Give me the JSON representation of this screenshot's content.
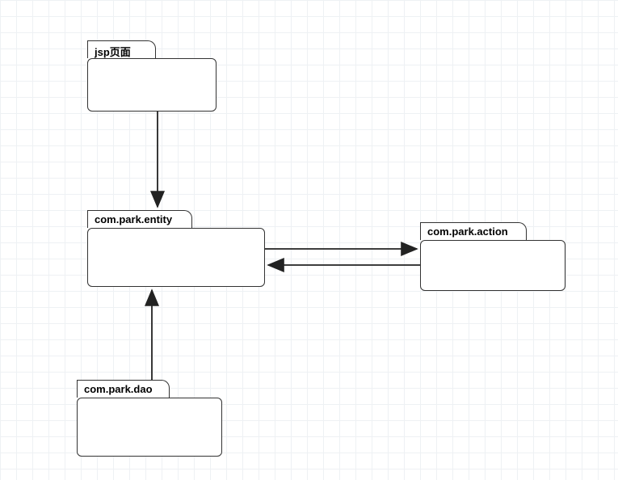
{
  "diagram": {
    "packages": {
      "jsp": {
        "label": "jsp页面"
      },
      "entity": {
        "label": "com.park.entity"
      },
      "action": {
        "label": "com.park.action"
      },
      "dao": {
        "label": "com.park.dao"
      }
    },
    "arrows": [
      {
        "from": "jsp",
        "to": "entity"
      },
      {
        "from": "entity",
        "to": "action"
      },
      {
        "from": "action",
        "to": "entity"
      },
      {
        "from": "dao",
        "to": "entity"
      }
    ]
  }
}
